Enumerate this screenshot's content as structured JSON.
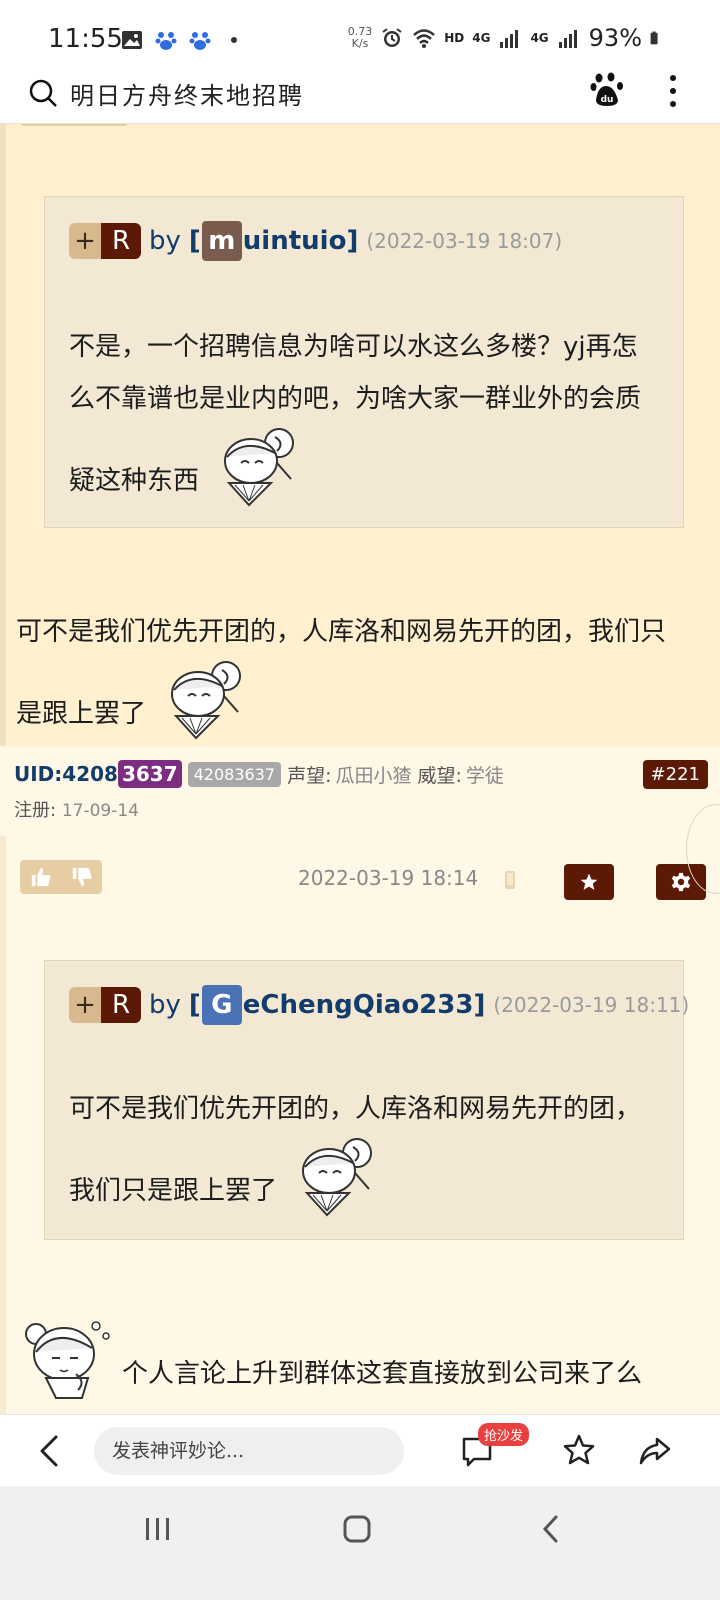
{
  "status_bar": {
    "time": "11:55",
    "net_speed_value": "0.73",
    "net_speed_unit": "K/s",
    "hd": "HD",
    "network": "4G",
    "battery": "93%"
  },
  "search": {
    "query": "明日方舟终末地招聘"
  },
  "post_a": {
    "quote": {
      "plus": "+",
      "r": "R",
      "by": "by",
      "bracket_open": "[",
      "avatar_letter": "m",
      "username_rest": "uintuio",
      "bracket_close": "]",
      "date": "(2022-03-19 18:07)",
      "line1": "不是，一个招聘信息为啥可以水这么多楼？yj再怎",
      "line2": "么不靠谱也是业内的吧，为啥大家一群业外的会质",
      "line3": "疑这种东西"
    },
    "reply_line1": "可不是我们优先开团的，人库洛和网易先开的团，我们只",
    "reply_line2": "是跟上罢了"
  },
  "meta": {
    "uid_label": "UID:4208",
    "uid_highlight": "3637",
    "uid_badge": "42083637",
    "reputation_label": "声望:",
    "reputation_value": "瓜田小猹",
    "prestige_label": "威望:",
    "prestige_value": "学徒",
    "floor": "#221",
    "register_label": "注册:",
    "register_date": "17-09-14"
  },
  "post_b": {
    "date": "2022-03-19 18:14",
    "quote": {
      "plus": "+",
      "r": "R",
      "by": "by",
      "bracket_open": "[",
      "avatar_letter": "G",
      "username_rest": "eChengQiao233",
      "bracket_close": "]",
      "date": "(2022-03-19 18:11)",
      "line1": "可不是我们优先开团的，人库洛和网易先开的团，",
      "line2": "我们只是跟上罢了"
    },
    "reply_text": "个人言论上升到群体这套直接放到公司来了么"
  },
  "comment_bar": {
    "placeholder": "发表神评妙论...",
    "sofa_badge": "抢沙发"
  },
  "colors": {
    "brand_dark": "#5b1906",
    "post_bg": "#fff0cf",
    "quote_bg": "#f2e8d3",
    "link_blue": "#123c6b",
    "uid_purple": "#7d2d80",
    "avatar_m": "#7a5c4e",
    "avatar_g": "#4a73b5",
    "sofa_red": "#e8413f"
  },
  "icons": {
    "search": "search-icon",
    "baidu": "paw-icon",
    "more": "more-vertical-icon",
    "star": "star-icon",
    "gear": "gear-icon",
    "thumb_up": "thumb-up-icon",
    "thumb_down": "thumb-down-icon",
    "back": "back-arrow-icon",
    "chat": "chat-icon",
    "share": "share-icon"
  }
}
